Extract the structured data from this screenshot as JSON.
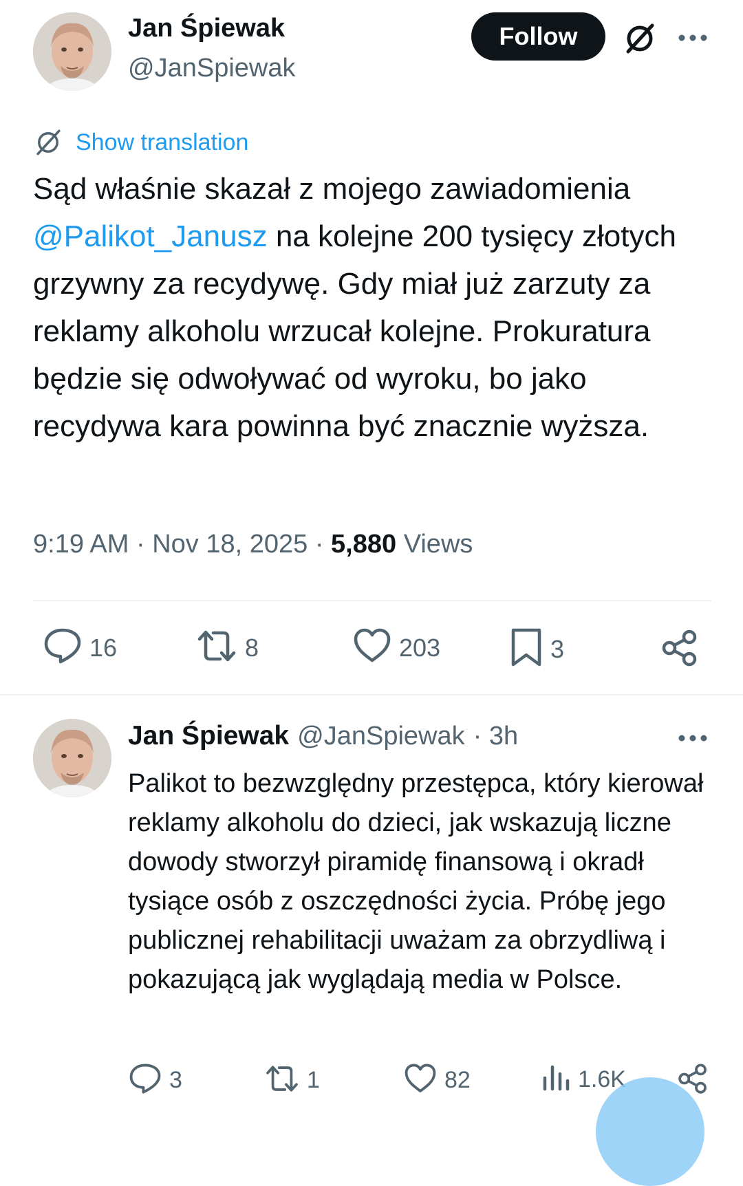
{
  "tweet": {
    "author": {
      "name": "Jan Śpiewak",
      "handle": "@JanSpiewak"
    },
    "follow_label": "Follow",
    "translate_label": "Show translation",
    "text_before_mention": "Sąd właśnie skazał z mojego zawiadomienia ",
    "mention": "@Palikot_Janusz",
    "text_after_mention": " na kolejne 200 tysięcy złotych grzywny za recydywę. Gdy miał już zarzuty za reklamy alkoholu wrzucał kolejne. Prokuratura będzie się odwoływać od wyroku, bo jako recydywa kara powinna być znacznie wyższa.",
    "time": "9:19 AM",
    "date": "Nov 18, 2025",
    "views_count": "5,880",
    "views_label": "Views",
    "actions": {
      "replies": "16",
      "reposts": "8",
      "likes": "203",
      "bookmarks": "3"
    }
  },
  "reply": {
    "author": {
      "name": "Jan Śpiewak",
      "handle": "@JanSpiewak"
    },
    "time": "· 3h",
    "text": "Palikot to bezwzględny przestępca, który kierował reklamy alkoholu do dzieci, jak wskazują liczne dowody stworzył piramidę finansową i okradł tysiące osób z oszczędności życia. Próbę jego publicznej rehabilitacji uważam za obrzydliwą i pokazującą jak wyglądają media w Polsce.",
    "actions": {
      "replies": "3",
      "reposts": "1",
      "likes": "82",
      "views": "1.6K"
    }
  },
  "colors": {
    "accent": "#1d9bf0",
    "text": "#0f1419",
    "secondary": "#536471",
    "divider": "#eff3f4"
  },
  "icons": [
    "grok-icon",
    "more-icon",
    "translate-icon",
    "reply-icon",
    "repost-icon",
    "like-icon",
    "bookmark-icon",
    "share-icon",
    "views-icon"
  ]
}
